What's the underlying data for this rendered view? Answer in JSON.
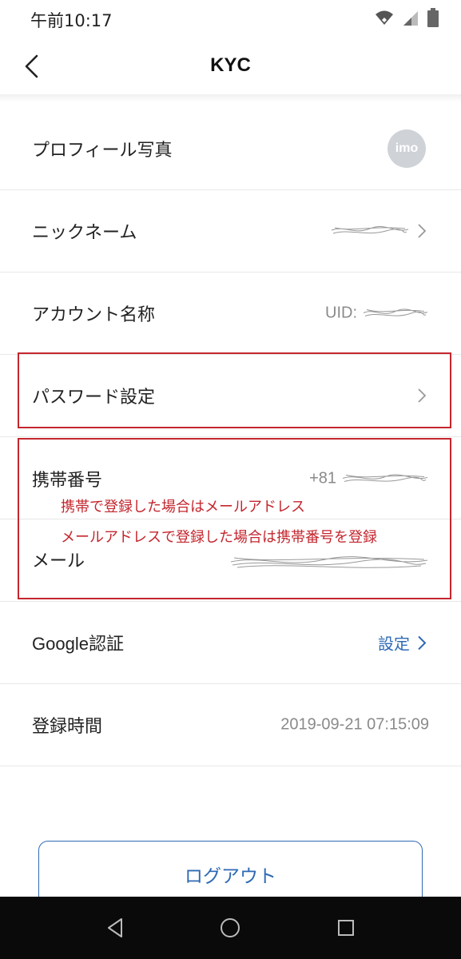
{
  "status_bar": {
    "time": "午前10:17"
  },
  "header": {
    "title": "KYC"
  },
  "rows": {
    "profile_photo": {
      "label": "プロフィール写真",
      "avatar_text": "imo"
    },
    "nickname": {
      "label": "ニックネーム"
    },
    "account_name": {
      "label": "アカウント名称",
      "value_prefix": "UID:"
    },
    "password": {
      "label": "パスワード設定"
    },
    "phone": {
      "label": "携帯番号",
      "value_prefix": "+81"
    },
    "mail": {
      "label": "メール"
    },
    "google_auth": {
      "label": "Google認証",
      "value": "設定"
    },
    "registered_time": {
      "label": "登録時間",
      "value": "2019-09-21 07:15:09"
    }
  },
  "annotations": {
    "line1": "携帯で登録した場合はメールアドレス",
    "line2": "メールアドレスで登録した場合は携帯番号を登録"
  },
  "logout": {
    "label": "ログアウト"
  },
  "colors": {
    "accent": "#2f6ab4",
    "annotation_red": "#c4262e",
    "value_gray": "#8a8a8a"
  }
}
